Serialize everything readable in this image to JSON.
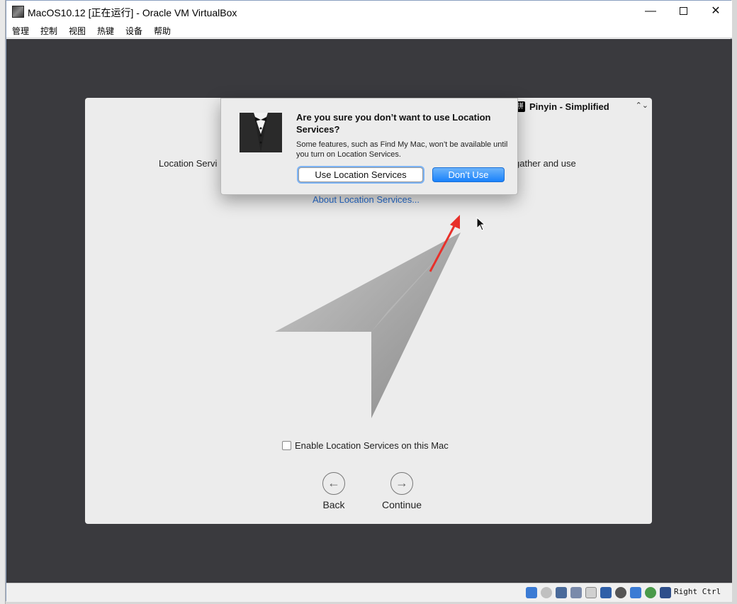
{
  "window": {
    "title": "MacOS10.12 [正在运行] - Oracle VM VirtualBox",
    "minimize_glyph": "—",
    "close_glyph": "✕"
  },
  "menubar": {
    "items": [
      "管理",
      "控制",
      "视图",
      "热键",
      "设备",
      "帮助"
    ]
  },
  "input_menu": {
    "icon_glyph": "拼",
    "label": "Pinyin - Simplified",
    "chevron": "⌃⌄"
  },
  "setup": {
    "description_left": "Location Servi",
    "description_right": "gather and use",
    "about_link": "About Location Services...",
    "checkbox_label": "Enable Location Services on this Mac",
    "back_label": "Back",
    "continue_label": "Continue",
    "back_glyph": "←",
    "continue_glyph": "→"
  },
  "dialog": {
    "title": "Are you sure you don’t want to use Location Services?",
    "body": "Some features, such as Find My Mac, won’t be available until you turn on Location Services.",
    "use_button": "Use Location Services",
    "dont_button": "Don’t Use"
  },
  "statusbar": {
    "host_key": "Right Ctrl"
  },
  "colors": {
    "vm_bg": "#3a3a3e",
    "panel_bg": "#ececec",
    "link": "#2a6fd0",
    "primary_button": "#1a82fb",
    "annotation_arrow": "#e8302a"
  }
}
